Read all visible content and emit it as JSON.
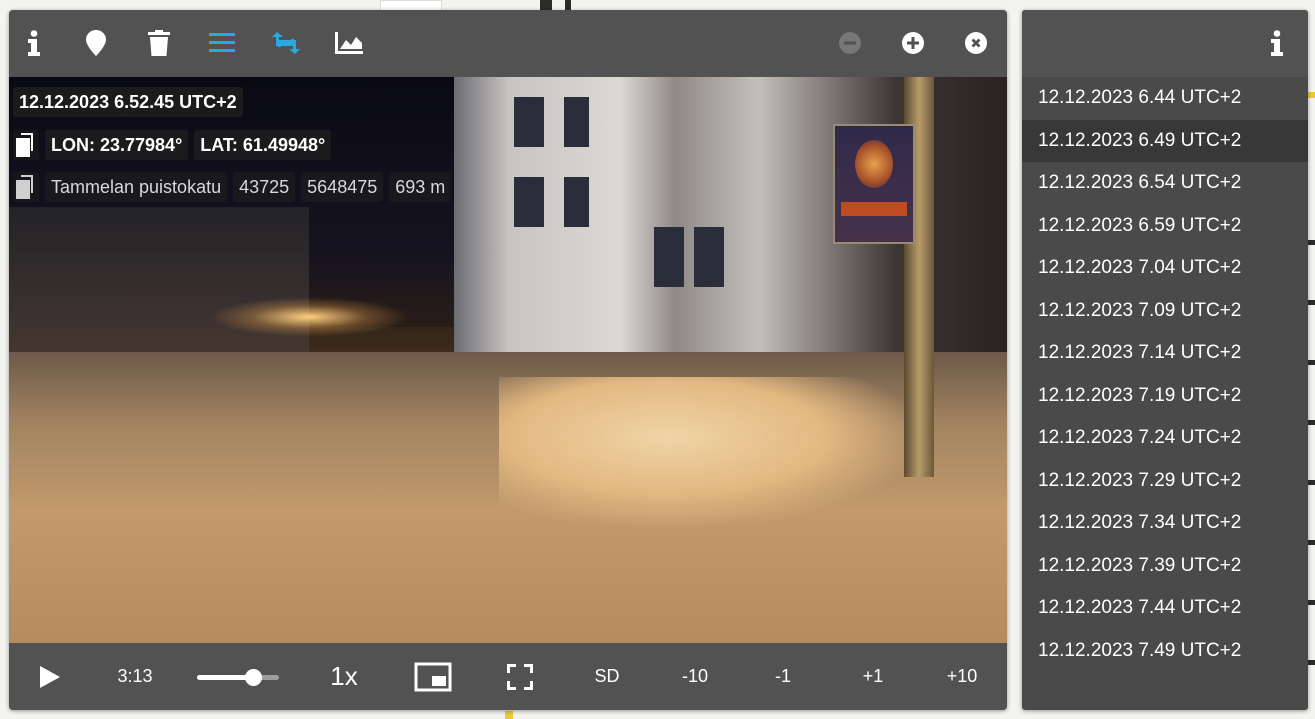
{
  "toolbar": {
    "icons": [
      "info-icon",
      "map-marker-icon",
      "trash-icon",
      "list-icon",
      "swap-icon",
      "chart-icon",
      "zoom-out-icon",
      "zoom-in-icon",
      "close-icon"
    ],
    "accent_color": "#2aa8e0"
  },
  "overlay": {
    "timestamp": "12.12.2023 6.52.45 UTC+2",
    "lon": "LON: 23.77984°",
    "lat": "LAT: 61.49948°",
    "street": "Tammelan puistokatu",
    "code1": "43725",
    "code2": "5648475",
    "distance": "693 m"
  },
  "controls": {
    "time": "3:13",
    "volume_fraction": 0.68,
    "speed": "1x",
    "quality": "SD",
    "minus10": "-10",
    "minus1": "-1",
    "plus1": "+1",
    "plus10": "+10"
  },
  "sidebar": {
    "selected_index": 1,
    "items": [
      "12.12.2023 6.44 UTC+2",
      "12.12.2023 6.49 UTC+2",
      "12.12.2023 6.54 UTC+2",
      "12.12.2023 6.59 UTC+2",
      "12.12.2023 7.04 UTC+2",
      "12.12.2023 7.09 UTC+2",
      "12.12.2023 7.14 UTC+2",
      "12.12.2023 7.19 UTC+2",
      "12.12.2023 7.24 UTC+2",
      "12.12.2023 7.29 UTC+2",
      "12.12.2023 7.34 UTC+2",
      "12.12.2023 7.39 UTC+2",
      "12.12.2023 7.44 UTC+2",
      "12.12.2023 7.49 UTC+2"
    ]
  }
}
